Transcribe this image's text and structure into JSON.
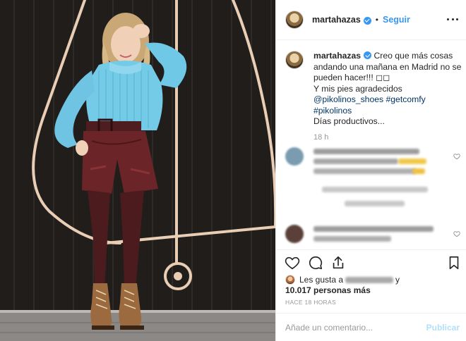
{
  "post": {
    "username": "martahazas",
    "follow_label": "Seguir",
    "separator": "•"
  },
  "caption": {
    "username": "martahazas",
    "line1": "Creo que más cosas andando una mañana en Madrid no se pueden hacer!!! ◻◻",
    "line2": "Y mis pies agradecidos",
    "tag1": "@pikolinos_shoes",
    "tag2": "#getcomfy",
    "tag3": "#pikolinos",
    "line4": "Días productivos...",
    "time": "18 h"
  },
  "likes": {
    "prefix": "Les gusta a",
    "connector": "y",
    "count_text": "10.017 personas más"
  },
  "timestamp": "HACE 18 HORAS",
  "comment_box": {
    "placeholder": "Añade un comentario...",
    "publish_label": "Publicar"
  },
  "icons": {
    "options": "more-horizontal-icon",
    "like": "heart-icon",
    "comment": "comment-bubble-icon",
    "share": "share-icon",
    "save": "bookmark-icon"
  },
  "colors": {
    "link": "#3897f0",
    "tag": "#003569",
    "muted": "#999999",
    "publish_disabled": "#b2dffc"
  }
}
